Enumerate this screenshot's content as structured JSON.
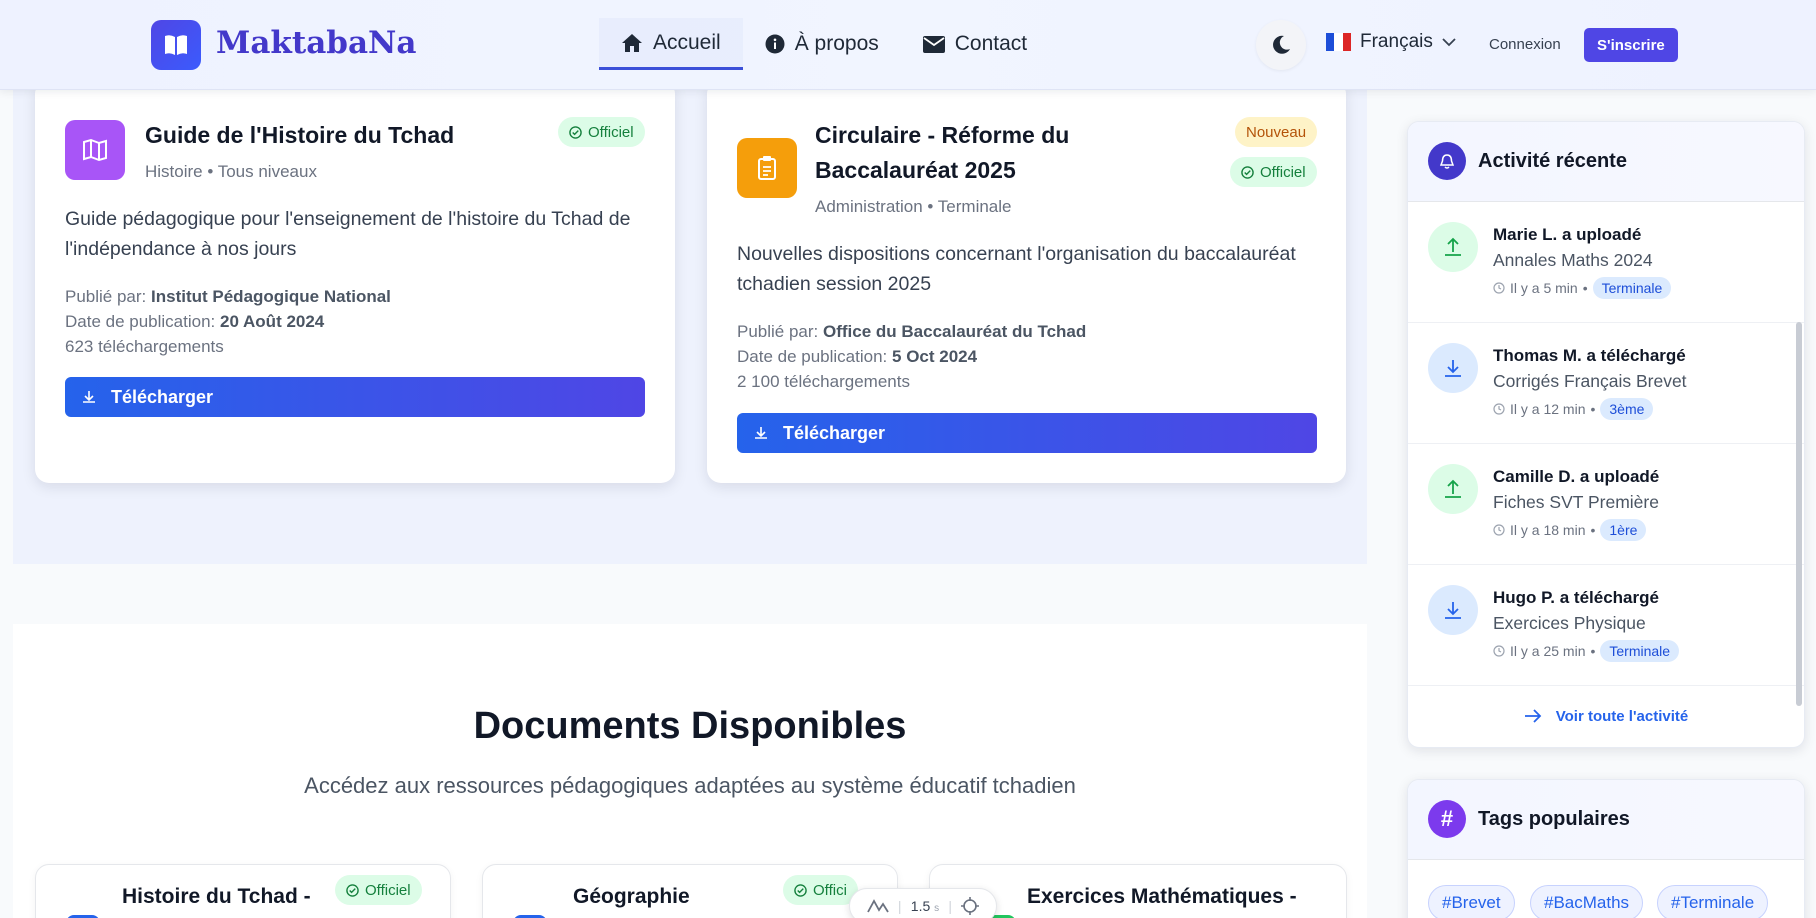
{
  "header": {
    "logo_text": "MaktabaNa",
    "nav": [
      {
        "label": "Accueil",
        "icon": "home-icon"
      },
      {
        "label": "À propos",
        "icon": "info-icon"
      },
      {
        "label": "Contact",
        "icon": "envelope-icon"
      }
    ],
    "language": "Français",
    "login_label": "Connexion",
    "signup_label": "S'inscrire"
  },
  "featured": [
    {
      "title": "Guide de l'Histoire du Tchad",
      "meta": "Histoire • Tous niveaux",
      "description": "Guide pédagogique pour l'enseignement de l'histoire du Tchad de l'indépendance à nos jours",
      "published_by_label": "Publié par:",
      "published_by": "Institut Pédagogique National",
      "date_label": "Date de publication:",
      "date": "20 Août 2024",
      "downloads": "623 téléchargements",
      "badges": [
        "Officiel"
      ],
      "download_label": "Télécharger",
      "icon": "map-icon",
      "icon_color": "#a855f7"
    },
    {
      "title": "Circulaire - Réforme du Baccalauréat 2025",
      "meta": "Administration • Terminale",
      "description": "Nouvelles dispositions concernant l'organisation du baccalauréat tchadien session 2025",
      "published_by_label": "Publié par:",
      "published_by": "Office du Baccalauréat du Tchad",
      "date_label": "Date de publication:",
      "date": "5 Oct 2024",
      "downloads": "2 100 téléchargements",
      "badges": [
        "Nouveau",
        "Officiel"
      ],
      "download_label": "Télécharger",
      "icon": "clipboard-icon",
      "icon_color": "#f59e0b"
    }
  ],
  "documents": {
    "title": "Documents Disponibles",
    "subtitle": "Accédez aux ressources pédagogiques adaptées au système éducatif tchadien",
    "cards": [
      {
        "title": "Histoire du Tchad -",
        "badge": "Officiel"
      },
      {
        "title": "Géographie",
        "badge": "Offici"
      },
      {
        "title": "Exercices Mathématiques -"
      }
    ]
  },
  "toolbar": {
    "value": "1.5",
    "unit": "s"
  },
  "activity": {
    "title": "Activité récente",
    "items": [
      {
        "title": "Marie L. a uploadé",
        "file": "Annales Maths 2024",
        "time": "Il y a 5 min",
        "tag": "Terminale",
        "type": "upload-icon"
      },
      {
        "title": "Thomas M. a téléchargé",
        "file": "Corrigés Français Brevet",
        "time": "Il y a 12 min",
        "tag": "3ème",
        "type": "download-icon"
      },
      {
        "title": "Camille D. a uploadé",
        "file": "Fiches SVT Première",
        "time": "Il y a 18 min",
        "tag": "1ère",
        "type": "upload-icon"
      },
      {
        "title": "Hugo P. a téléchargé",
        "file": "Exercices Physique",
        "time": "Il y a 25 min",
        "tag": "Terminale",
        "type": "download-icon"
      }
    ],
    "see_all": "Voir toute l'activité"
  },
  "tags": {
    "title": "Tags populaires",
    "items": [
      "#Brevet",
      "#BacMaths",
      "#Terminale"
    ]
  },
  "colors": {
    "accent": "#4f46e5",
    "success": "#15803d",
    "warning": "#b45309"
  }
}
